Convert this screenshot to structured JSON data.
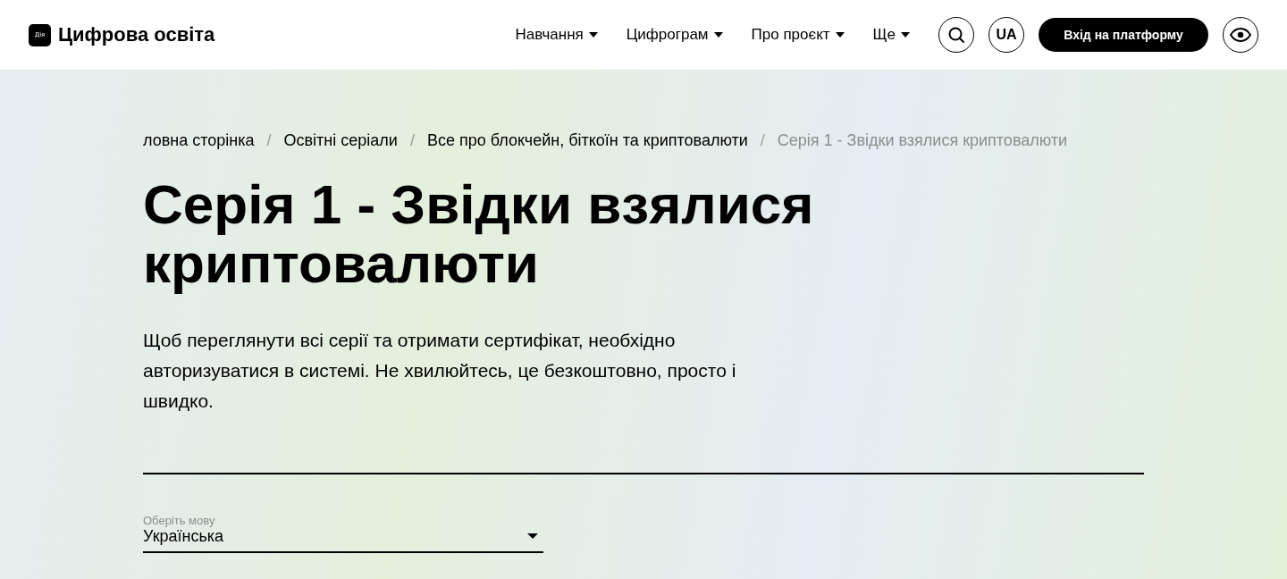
{
  "header": {
    "logo_badge": "Дія",
    "logo_text": "Цифрова освіта",
    "nav": [
      {
        "label": "Навчання"
      },
      {
        "label": "Цифрограм"
      },
      {
        "label": "Про проєкт"
      },
      {
        "label": "Ще"
      }
    ],
    "language": "UA",
    "login_button": "Вхід на платформу"
  },
  "breadcrumb_separator": "/",
  "breadcrumbs": [
    {
      "label": "ловна сторінка",
      "current": false
    },
    {
      "label": "Освітні серіали",
      "current": false
    },
    {
      "label": "Все про блокчейн, біткоїн та криптовалюти",
      "current": false
    },
    {
      "label": "Серія 1 - Звідки взялися криптовалюти",
      "current": true
    }
  ],
  "title": "Серія 1 - Звідки взялися криптовалюти",
  "description": "Щоб переглянути всі серії та отримати сертифікат, необхідно авторизуватися в системі. Не хвилюйтесь, це безкоштовно, просто і швидко.",
  "language_select": {
    "label": "Оберіть мову",
    "value": "Українська"
  }
}
